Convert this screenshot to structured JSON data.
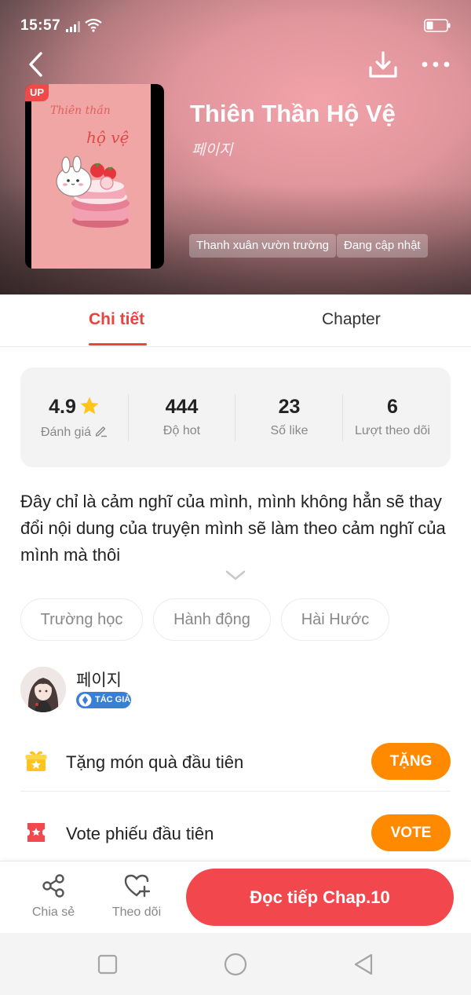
{
  "status_bar": {
    "time": "15:57",
    "signal_icon": "signal-icon",
    "wifi_icon": "wifi-icon",
    "battery_icon": "battery-icon"
  },
  "header": {
    "back_icon": "back-arrow-icon",
    "download_icon": "download-icon",
    "more_icon": "more-dots-icon",
    "cover": {
      "badge": "UP",
      "title_line_1": "Thiên thần",
      "title_line_2": "hộ vệ"
    },
    "title": "Thiên Thần Hộ Vệ",
    "author": "페이지",
    "genres": [
      "Thanh xuân vườn trường",
      "Đang cập nhật"
    ]
  },
  "tabs": [
    {
      "label": "Chi tiết",
      "active": true
    },
    {
      "label": "Chapter",
      "active": false
    }
  ],
  "stats": [
    {
      "value": "4.9",
      "label": "Đánh giá",
      "icon": "star-icon",
      "label_icon": "edit-icon"
    },
    {
      "value": "444",
      "label": "Độ hot"
    },
    {
      "value": "23",
      "label": "Số like"
    },
    {
      "value": "6",
      "label": "Lượt theo dõi"
    }
  ],
  "description": "Đây chỉ là cảm nghĩ của mình, mình không hẳn sẽ thay đổi nội dung của truyện mình sẽ làm theo cảm nghĩ của mình mà thôi",
  "expand_icon": "chevron-down-icon",
  "categories": [
    "Trường học",
    "Hành động",
    "Hài Hước"
  ],
  "author": {
    "name": "페이지",
    "badge": "TÁC GIẢ"
  },
  "actions": [
    {
      "label": "Tặng món quà đầu tiên",
      "button": "TẶNG",
      "icon": "gift-icon"
    },
    {
      "label": "Vote phiếu đầu tiên",
      "button": "VOTE",
      "icon": "ticket-icon"
    }
  ],
  "bottom_bar": {
    "share_label": "Chia sẻ",
    "follow_label": "Theo dõi",
    "read_label": "Đọc tiếp Chap.10"
  },
  "colors": {
    "accent": "#e8433f",
    "button_orange": "#ff8a00",
    "read_button": "#f2474c"
  }
}
